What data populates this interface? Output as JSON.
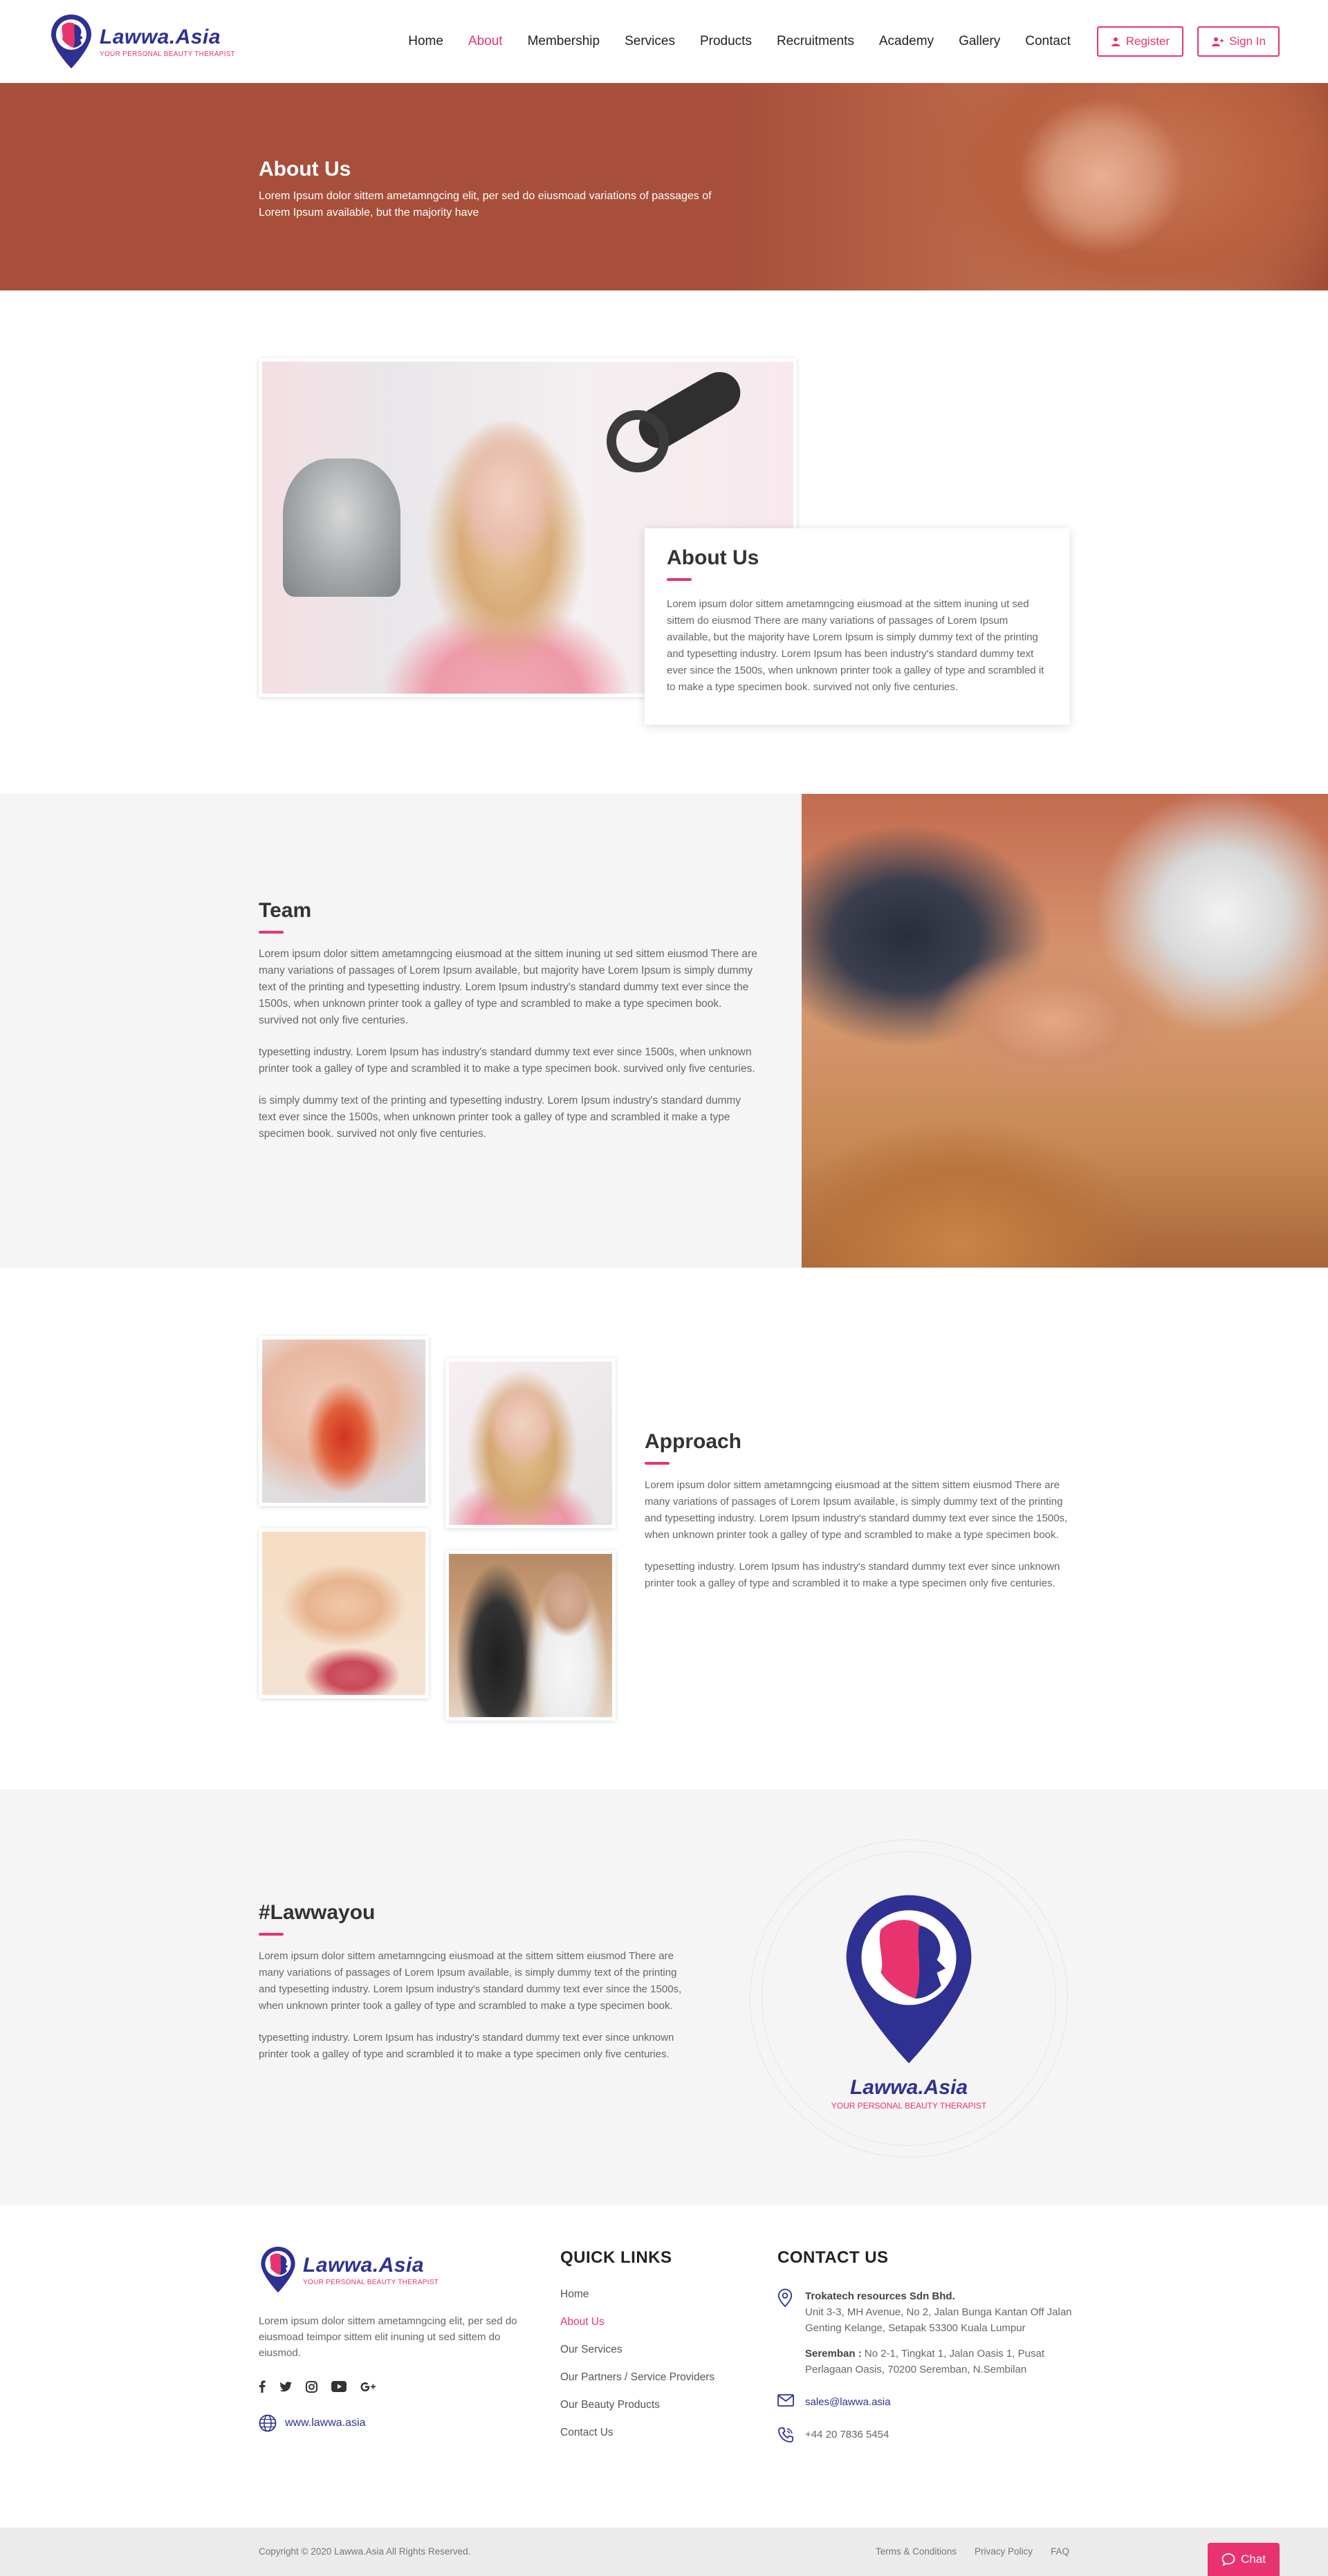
{
  "brand": {
    "name": "Lawwa.Asia",
    "tagline": "YOUR PERSONAL BEAUTY THERAPIST",
    "colors": {
      "primary": "#2e3192",
      "accent": "#e8336f",
      "hero": "#a74f3b"
    }
  },
  "nav": {
    "items": [
      {
        "label": "Home",
        "active": false
      },
      {
        "label": "About",
        "active": true
      },
      {
        "label": "Membership",
        "active": false
      },
      {
        "label": "Services",
        "active": false
      },
      {
        "label": "Products",
        "active": false
      },
      {
        "label": "Recruitments",
        "active": false
      },
      {
        "label": "Academy",
        "active": false
      },
      {
        "label": "Gallery",
        "active": false
      },
      {
        "label": "Contact",
        "active": false
      }
    ],
    "register_label": "Register",
    "signin_label": "Sign In"
  },
  "hero": {
    "title": "About Us",
    "text": "Lorem Ipsum dolor sittem ametamngcing elit, per sed do eiusmoad variations of passages of Lorem Ipsum available, but the majority have"
  },
  "about": {
    "title": "About Us",
    "text": "Lorem ipsum dolor sittem ametamngcing eiusmoad at the sittem inuning ut sed sittem do eiusmod There are many variations of passages of Lorem Ipsum available, but the majority have Lorem Ipsum is simply dummy text of the printing and typesetting industry. Lorem Ipsum has been industry's standard dummy text ever since the 1500s, when unknown printer took a galley of type and scrambled it to make a type specimen book. survived not only five centuries."
  },
  "team": {
    "title": "Team",
    "paragraphs": [
      "Lorem ipsum dolor sittem ametamngcing eiusmoad at the sittem inuning ut sed sittem eiusmod There are many variations of passages of Lorem Ipsum available, but majority have Lorem Ipsum is simply dummy text of the printing and typesetting industry. Lorem Ipsum industry's standard dummy text ever since the 1500s, when unknown printer took a galley of type and scrambled to make a type specimen book. survived not only five centuries.",
      "typesetting industry. Lorem Ipsum has industry's standard dummy text ever since 1500s, when unknown printer took a galley of type and scrambled it to make a type specimen book. survived only five centuries.",
      "is simply dummy text of the printing and typesetting industry. Lorem Ipsum industry's standard dummy text ever since the 1500s, when unknown printer took a galley of type and scrambled it make a type specimen book. survived not only five centuries."
    ]
  },
  "approach": {
    "title": "Approach",
    "paragraphs": [
      "Lorem ipsum dolor sittem ametamngcing eiusmoad at the sittem sittem eiusmod There are many variations of passages of Lorem Ipsum available, is simply dummy text of the printing and typesetting industry. Lorem Ipsum industry's standard dummy text ever since the 1500s, when unknown printer took a galley of type and scrambled to make a type specimen book.",
      "typesetting industry. Lorem Ipsum has industry's standard dummy text ever since unknown printer took a galley of type and scrambled it to make a type specimen only five centuries."
    ]
  },
  "hashtag": {
    "title": "#Lawwayou",
    "paragraphs": [
      "Lorem ipsum dolor sittem ametamngcing eiusmoad at the sittem sittem eiusmod There are many variations of passages of Lorem Ipsum available, is simply dummy text of the printing and typesetting industry. Lorem Ipsum industry's standard dummy text ever since the 1500s, when unknown printer took a galley of type and scrambled to make a type specimen book.",
      "typesetting industry. Lorem Ipsum has industry's standard dummy text ever since unknown printer took a galley of type and scrambled it to make a type specimen only five centuries."
    ]
  },
  "footer": {
    "description": "Lorem ipsum dolor sittem ametamngcing elit, per sed do eiusmoad teimpor sittem elit inuning ut sed sittem do eiusmod.",
    "socials": [
      "facebook-icon",
      "twitter-icon",
      "instagram-icon",
      "youtube-icon",
      "google-plus-icon"
    ],
    "website": "www.lawwa.asia",
    "quick_links_heading": "QUICK LINKS",
    "quick_links": [
      {
        "label": "Home",
        "active": false
      },
      {
        "label": "About Us",
        "active": true
      },
      {
        "label": "Our Services",
        "active": false
      },
      {
        "label": "Our Partners / Service Providers",
        "active": false
      },
      {
        "label": "Our Beauty Products",
        "active": false
      },
      {
        "label": "Contact Us",
        "active": false
      }
    ],
    "contact_heading": "CONTACT US",
    "company": "Trokatech resources Sdn Bhd.",
    "address_main": "Unit 3-3, MH Avenue, No 2, Jalan Bunga Kantan Off Jalan Genting Kelange, Setapak 53300 Kuala Lumpur",
    "branch_label": "Seremban :",
    "branch_address": "No 2-1, Tingkat 1, Jalan Oasis 1, Pusat Perlagaan Oasis, 70200 Seremban, N.Sembilan",
    "email": "sales@lawwa.asia",
    "phone": "+44 20 7836 5454"
  },
  "bottom": {
    "copyright": "Copyright © 2020 Lawwa.Asia All Rights Reserved.",
    "links": [
      "Terms & Conditions",
      "Privacy Policy",
      "FAQ"
    ],
    "chat_label": "Chat"
  }
}
